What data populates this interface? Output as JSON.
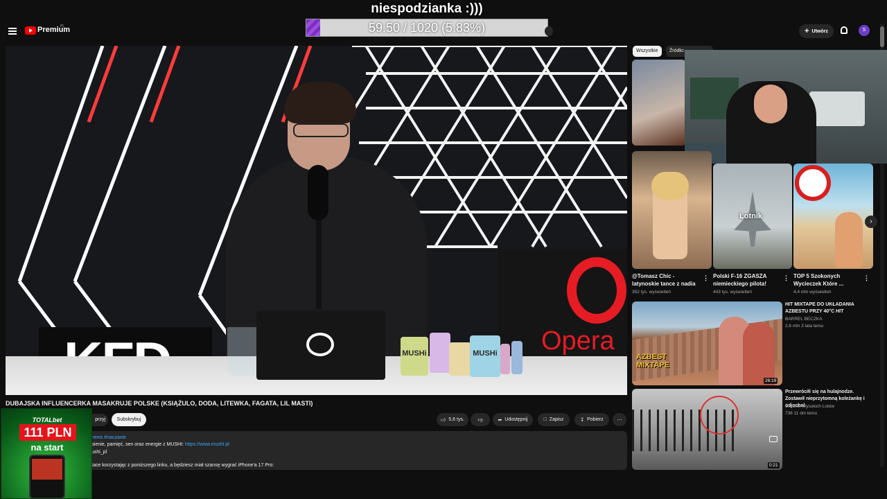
{
  "overlay": {
    "title": "niespodzianka :)))",
    "goal_text": "59.50 / 1020 (5.83%)",
    "goal_fraction": 0.0583
  },
  "header": {
    "brand": "Premium",
    "region": "PL",
    "create_label": "Utwórz",
    "avatar_letter": "S"
  },
  "video": {
    "title": "DUBAJSKA INFLUENCERKA MASAKRUJE POLSKE (KSIĄŻULO, DODA, LITEWKA, FAGATA, LIL MASTI)",
    "scene_kfd": "KFD",
    "scene_opera": "Opera G",
    "jar_label": "MUSHi"
  },
  "actions": {
    "join": "przyj",
    "subscribe": "Subskrybuj",
    "likes": "5,6 tys.",
    "share": "Udostępnij",
    "save": "Zapisz",
    "download": "Pobierz"
  },
  "description": {
    "line1": "news #naczasie",
    "line2_text": "pienie, pamięć, sen oraz energie z MUSHI:",
    "line2_link": "https://www.mushi.pl",
    "line3": "ushi_pl",
    "line4": "tace korzystając z poniższego linku, a będziesz miał szansę wygrać iPhone'a 17 Pro:"
  },
  "ad": {
    "brand": "TOTALbet",
    "amount": "111 PLN",
    "tagline": "na start"
  },
  "chips": [
    "Wszystkie",
    "Źródło: ..."
  ],
  "sidebar": {
    "row_videos": [
      {
        "title": "@Tomasz Chic - latynoskie tance z nadia",
        "meta": "352 tys. wyświetleń"
      },
      {
        "title": "Polski F-16 ZGASZA niemieckiego pilota!",
        "meta": "443 tys. wyświetleń",
        "thumb_text": "Lotnik"
      },
      {
        "title": "TOP 5 Szokonych Wycieczek Które ...",
        "meta": "4,4 mln wyświetleń"
      }
    ],
    "list_videos": [
      {
        "title": "HIT MIXTAPE DO UKŁADANIA AZBESTU PRZY 40°C HIT",
        "channel": "BARREL BECZKA",
        "meta": "2,6 mln  3 lata temu",
        "duration": "26:19",
        "thumb_text": "AZBEST MIXTAPE"
      },
      {
        "title": "Przewróciłi się na hulajnodze. Zostawił nieprzytomną koleżankę i odjechał",
        "channel": "Świdnik Wysokich Lotów",
        "meta": "736  11 dni temu",
        "duration": "0:21"
      }
    ]
  },
  "colors": {
    "accent_red": "#ff0000",
    "goal_purple": "#7b2fbf",
    "opera_red": "#e51c24",
    "link_blue": "#3ea6ff"
  }
}
